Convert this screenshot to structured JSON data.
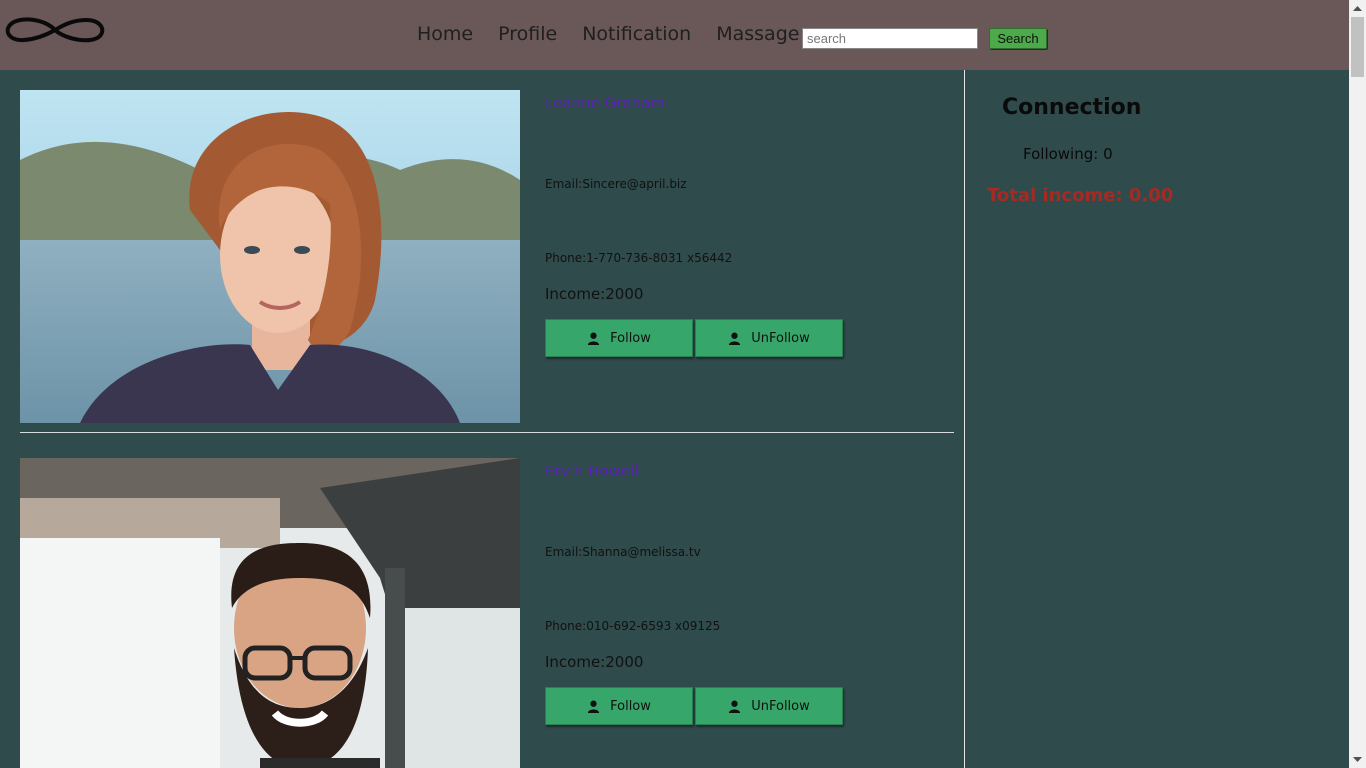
{
  "header": {
    "logo_icon": "infinity-icon",
    "nav": [
      "Home",
      "Profile",
      "Notification",
      "Massage"
    ],
    "search_placeholder": "search",
    "search_button": "Search"
  },
  "users": [
    {
      "name": "Leanne Graham",
      "email": "Email:Sincere@april.biz",
      "phone": "Phone:1-770-736-8031 x56442",
      "income": "Income:2000",
      "follow_label": "Follow",
      "unfollow_label": "UnFollow",
      "photo_icon": "user-photo"
    },
    {
      "name": "Ervin Howell",
      "email": "Email:Shanna@melissa.tv",
      "phone": "Phone:010-692-6593 x09125",
      "income": "Income:2000",
      "follow_label": "Follow",
      "unfollow_label": "UnFollow",
      "photo_icon": "user-photo"
    }
  ],
  "sidebar": {
    "title": "Connection",
    "following": "Following: 0",
    "total_income": "Total income: 0.00"
  },
  "colors": {
    "header_bg": "#6a5757",
    "page_bg": "#2f4b4c",
    "button_green": "#37a66a",
    "name_purple": "#5a1fb5",
    "income_red": "#a62a22"
  }
}
